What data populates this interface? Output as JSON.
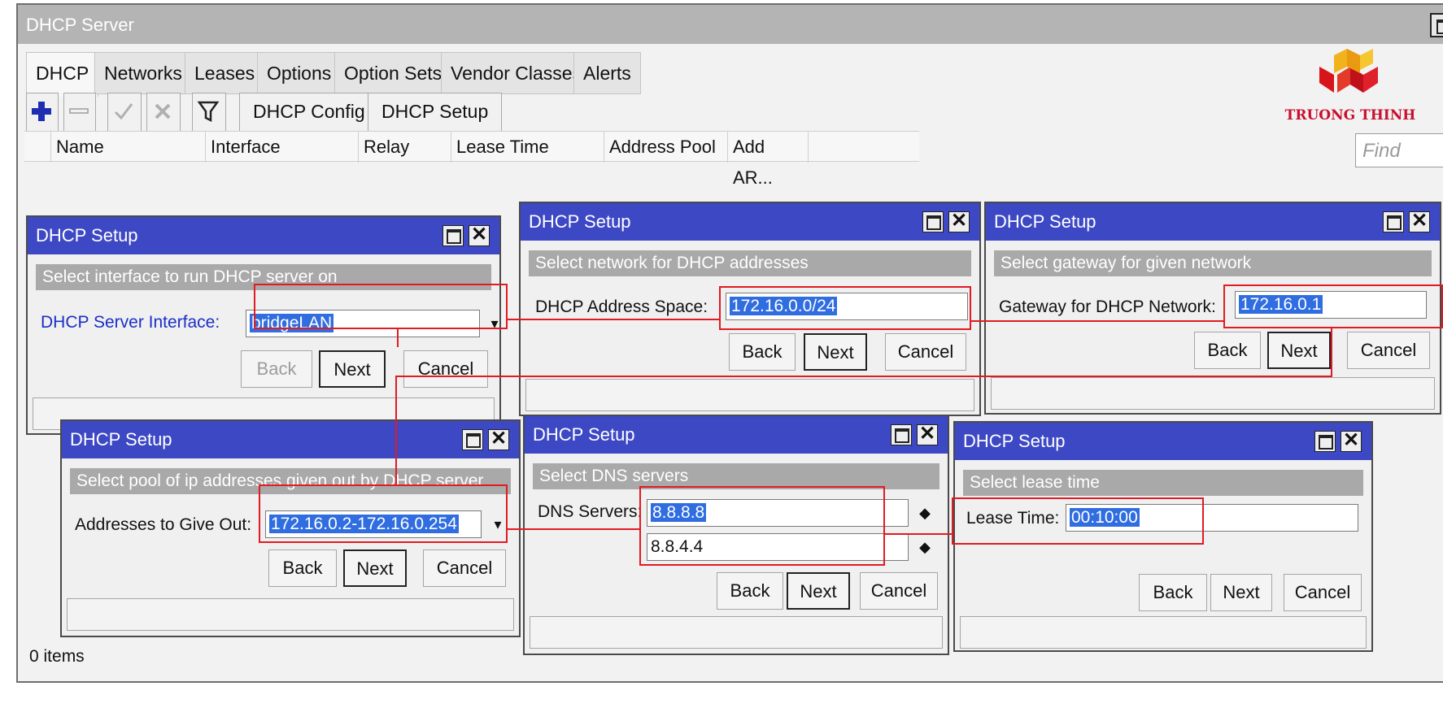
{
  "window": {
    "title": "DHCP Server"
  },
  "tabs": [
    "DHCP",
    "Networks",
    "Leases",
    "Options",
    "Option Sets",
    "Vendor Classes",
    "Alerts"
  ],
  "toolbar": {
    "dhcp_config": "DHCP Config",
    "dhcp_setup": "DHCP Setup"
  },
  "columns": [
    "Name",
    "Interface",
    "Relay",
    "Lease Time",
    "Address Pool",
    "Add AR..."
  ],
  "find": {
    "placeholder": "Find"
  },
  "status": "0 items",
  "logo": {
    "text": "TRUONG THINH"
  },
  "buttons": {
    "back": "Back",
    "next": "Next",
    "cancel": "Cancel"
  },
  "dialogs": [
    {
      "title": "DHCP Setup",
      "subtitle": "Select interface to run DHCP server on",
      "label": "DHCP Server Interface:",
      "value": "bridgeLAN"
    },
    {
      "title": "DHCP Setup",
      "subtitle": "Select network for DHCP addresses",
      "label": "DHCP Address Space:",
      "value": "172.16.0.0/24"
    },
    {
      "title": "DHCP Setup",
      "subtitle": "Select gateway for given network",
      "label": "Gateway for DHCP Network:",
      "value": "172.16.0.1"
    },
    {
      "title": "DHCP Setup",
      "subtitle": "Select pool of ip addresses given out by DHCP server",
      "label": "Addresses to Give Out:",
      "value": "172.16.0.2-172.16.0.254"
    },
    {
      "title": "DHCP Setup",
      "subtitle": "Select DNS servers",
      "label": "DNS Servers:",
      "value": "8.8.8.8",
      "value2": "8.8.4.4"
    },
    {
      "title": "DHCP Setup",
      "subtitle": "Select lease time",
      "label": "Lease Time:",
      "value": "00:10:00"
    }
  ]
}
